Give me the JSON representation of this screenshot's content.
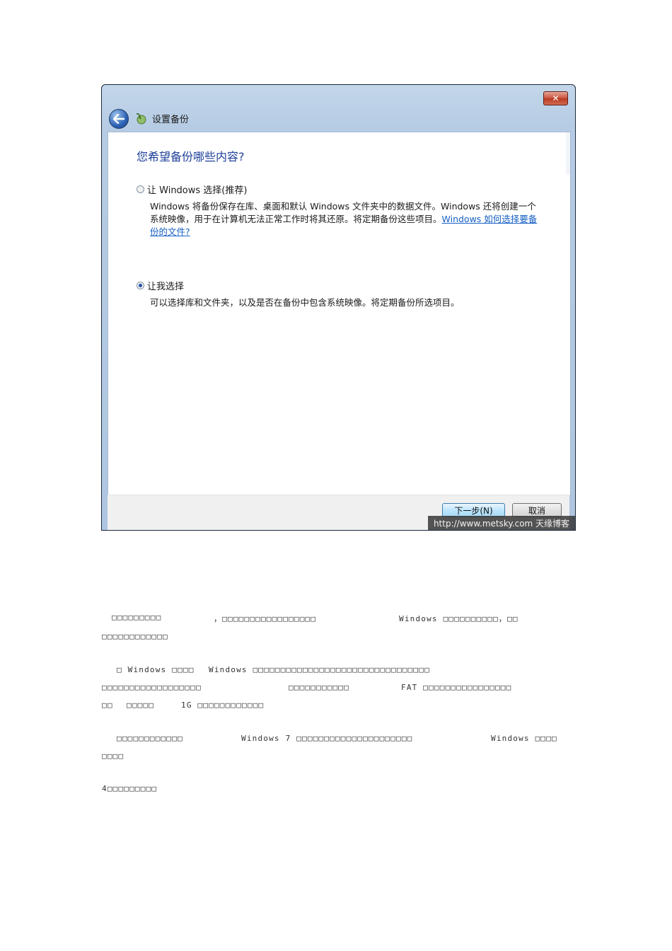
{
  "window": {
    "close_label": "✕",
    "title": "设置备份",
    "heading": "您希望备份哪些内容?",
    "option1": {
      "label": "让 Windows 选择(推荐)",
      "checked": false,
      "desc_line1": "Windows 将备份保存在库、桌面和默认 Windows 文件夹中的数据文件。Windows 还将创建一个",
      "desc_line2": "系统映像，用于在计算机无法正常工作时将其还原。将定期备份这些项目。",
      "link_part1": "Windows 如何选择要备",
      "link_part2": "份的文件?"
    },
    "option2": {
      "label": "让我选择",
      "checked": true,
      "desc": "可以选择库和文件夹，以及是否在备份中包含系统映像。将定期备份所选项目。"
    },
    "next_button": "下一步(N)",
    "cancel_button": "取消",
    "watermark": "http://www.metsky.com  天缘博客"
  },
  "doc": {
    "p1_l1_a": "□□□□□□□□□",
    "p1_l1_b": "，□□□□□□□□□□□□□□□□□",
    "p1_l1_c": "Windows □□□□□□□□□□，□□",
    "p1_l2": "□□□□□□□□□□□□",
    "p2_l1_a": "□ Windows □□□□",
    "p2_l1_b": "Windows □□□□□□□□□□□□□□□□□□□□□□□□□□□□□□□□",
    "p2_l2_a": "□□□□□□□□□□□□□□□□□□",
    "p2_l2_b": "□□□□□□□□□□□",
    "p2_l2_c": "FAT □□□□□□□□□□□□□□□□",
    "p2_l3_a": "□□",
    "p2_l3_b": "□□□□□",
    "p2_l3_c": "1G □□□□□□□□□□□□",
    "p3_l1_a": "□□□□□□□□□□□□",
    "p3_l1_b": "Windows 7 □□□□□□□□□□□□□□□□□□□□□",
    "p3_l1_c": "Windows □□□□",
    "p3_l2": "□□□□",
    "p4": "4□□□□□□□□□"
  }
}
